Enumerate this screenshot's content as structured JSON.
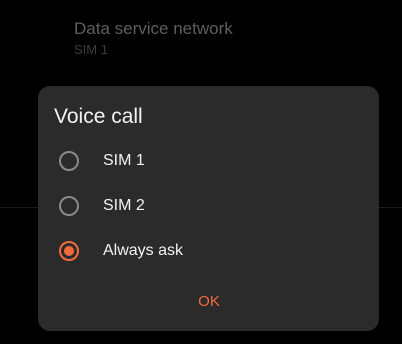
{
  "background_setting": {
    "title": "Data service network",
    "subtitle": "SIM 1"
  },
  "dialog": {
    "title": "Voice call",
    "options": [
      {
        "label": "SIM 1",
        "selected": false
      },
      {
        "label": "SIM 2",
        "selected": false
      },
      {
        "label": "Always ask",
        "selected": true
      }
    ],
    "ok_label": "OK"
  },
  "colors": {
    "accent": "#f26b3a",
    "dialog_bg": "#2b2b2b",
    "screen_bg": "#000000"
  }
}
